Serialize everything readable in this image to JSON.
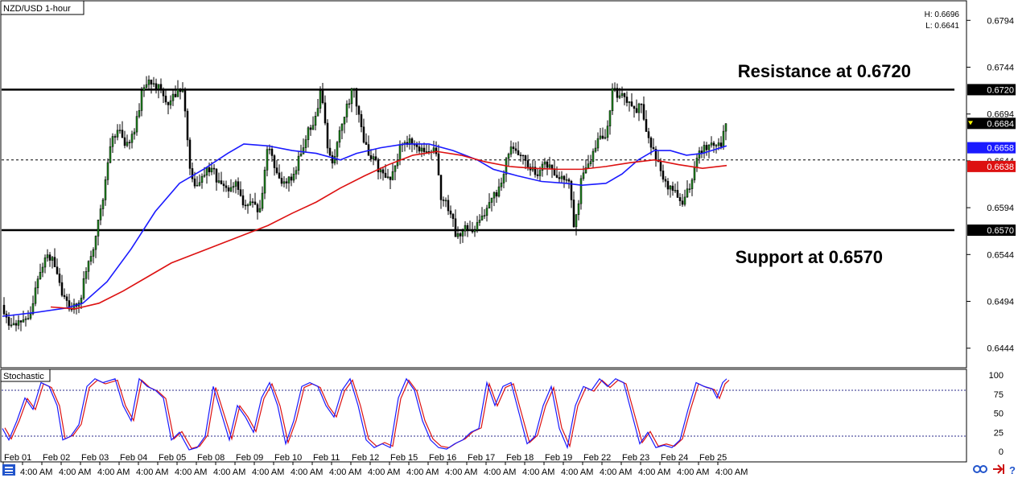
{
  "chart_data": {
    "type": "candlestick",
    "title": "NZD/USD 1-hour",
    "high_low": {
      "high_label": "H: 0.6696",
      "low_label": "L: 0.6641"
    },
    "price_axis": {
      "ylim": [
        0.6424,
        0.6814
      ],
      "ticks": [
        "0.6794",
        "0.6744",
        "0.6694",
        "0.6644",
        "0.6594",
        "0.6544",
        "0.6494",
        "0.6444"
      ],
      "tick_values": [
        0.6794,
        0.6744,
        0.6694,
        0.6644,
        0.6594,
        0.6544,
        0.6494,
        0.6444
      ]
    },
    "time_axis": {
      "labels": [
        "Feb 01",
        "4:00 AM",
        "Feb 02",
        "4:00 AM",
        "Feb 03",
        "4:00 AM",
        "Feb 04",
        "4:00 AM",
        "Feb 05",
        "4:00 AM",
        "Feb 08",
        "4:00 AM",
        "Feb 09",
        "4:00 AM",
        "Feb 10",
        "4:00 AM",
        "Feb 11",
        "4:00 AM",
        "Feb 12",
        "4:00 AM",
        "Feb 15",
        "4:00 AM",
        "Feb 16",
        "4:00 AM",
        "Feb 17",
        "4:00 AM",
        "Feb 18",
        "4:00 AM",
        "Feb 19",
        "4:00 AM",
        "Feb 22",
        "4:00 AM",
        "Feb 23",
        "4:00 AM",
        "Feb 24",
        "4:00 AM",
        "Feb 25",
        "4:00 AM"
      ]
    },
    "levels": [
      {
        "name": "Resistance",
        "value": 0.672,
        "tag": "0.6720",
        "annotation": "Resistance at 0.6720",
        "color": "#000000"
      },
      {
        "name": "Support",
        "value": 0.657,
        "tag": "0.6570",
        "annotation": "Support at 0.6570",
        "color": "#000000"
      }
    ],
    "current_price": {
      "value": 0.6684,
      "tag": "0.6684",
      "color": "#ffff00"
    },
    "bid_line": {
      "value": 0.6645
    },
    "moving_averages": [
      {
        "color": "#1a1aff",
        "last_value": 0.6658,
        "tag": "0.6658",
        "points": [
          [
            0,
            0.6478
          ],
          [
            40,
            0.6482
          ],
          [
            80,
            0.6487
          ],
          [
            100,
            0.6492
          ],
          [
            130,
            0.6515
          ],
          [
            160,
            0.655
          ],
          [
            190,
            0.659
          ],
          [
            220,
            0.662
          ],
          [
            250,
            0.6635
          ],
          [
            280,
            0.6652
          ],
          [
            300,
            0.6662
          ],
          [
            330,
            0.666
          ],
          [
            360,
            0.6655
          ],
          [
            390,
            0.6652
          ],
          [
            420,
            0.6645
          ],
          [
            440,
            0.6652
          ],
          [
            470,
            0.6658
          ],
          [
            500,
            0.6662
          ],
          [
            530,
            0.6662
          ],
          [
            560,
            0.6655
          ],
          [
            590,
            0.6645
          ],
          [
            610,
            0.6635
          ],
          [
            640,
            0.6628
          ],
          [
            670,
            0.6622
          ],
          [
            700,
            0.662
          ],
          [
            720,
            0.6618
          ],
          [
            750,
            0.662
          ],
          [
            770,
            0.663
          ],
          [
            790,
            0.6645
          ],
          [
            810,
            0.6655
          ],
          [
            830,
            0.6655
          ],
          [
            850,
            0.665
          ],
          [
            870,
            0.6652
          ],
          [
            900,
            0.666
          ]
        ]
      },
      {
        "color": "#dd1111",
        "last_value": 0.6638,
        "tag": "0.6638",
        "points": [
          [
            60,
            0.6488
          ],
          [
            90,
            0.6486
          ],
          [
            120,
            0.6492
          ],
          [
            150,
            0.6505
          ],
          [
            180,
            0.652
          ],
          [
            210,
            0.6535
          ],
          [
            240,
            0.6545
          ],
          [
            270,
            0.6555
          ],
          [
            300,
            0.6565
          ],
          [
            330,
            0.6575
          ],
          [
            360,
            0.6588
          ],
          [
            390,
            0.66
          ],
          [
            420,
            0.6615
          ],
          [
            450,
            0.6628
          ],
          [
            480,
            0.664
          ],
          [
            510,
            0.665
          ],
          [
            540,
            0.6654
          ],
          [
            570,
            0.665
          ],
          [
            600,
            0.6643
          ],
          [
            630,
            0.6638
          ],
          [
            660,
            0.6636
          ],
          [
            690,
            0.6635
          ],
          [
            720,
            0.6635
          ],
          [
            750,
            0.6638
          ],
          [
            780,
            0.6642
          ],
          [
            810,
            0.6645
          ],
          [
            840,
            0.664
          ],
          [
            870,
            0.6636
          ],
          [
            900,
            0.6639
          ]
        ]
      }
    ],
    "price_path": [
      [
        0,
        0.649
      ],
      [
        10,
        0.6465
      ],
      [
        22,
        0.6472
      ],
      [
        35,
        0.648
      ],
      [
        45,
        0.652
      ],
      [
        55,
        0.6545
      ],
      [
        65,
        0.6535
      ],
      [
        75,
        0.65
      ],
      [
        85,
        0.6485
      ],
      [
        95,
        0.649
      ],
      [
        105,
        0.653
      ],
      [
        115,
        0.656
      ],
      [
        125,
        0.66
      ],
      [
        135,
        0.6665
      ],
      [
        145,
        0.6675
      ],
      [
        155,
        0.666
      ],
      [
        165,
        0.668
      ],
      [
        175,
        0.6725
      ],
      [
        185,
        0.673
      ],
      [
        195,
        0.672
      ],
      [
        205,
        0.6705
      ],
      [
        215,
        0.6715
      ],
      [
        225,
        0.672
      ],
      [
        232,
        0.664
      ],
      [
        240,
        0.6615
      ],
      [
        250,
        0.663
      ],
      [
        260,
        0.6635
      ],
      [
        270,
        0.662
      ],
      [
        280,
        0.6615
      ],
      [
        290,
        0.662
      ],
      [
        300,
        0.659
      ],
      [
        310,
        0.66
      ],
      [
        320,
        0.659
      ],
      [
        330,
        0.666
      ],
      [
        340,
        0.663
      ],
      [
        350,
        0.662
      ],
      [
        360,
        0.6625
      ],
      [
        370,
        0.665
      ],
      [
        380,
        0.6675
      ],
      [
        390,
        0.669
      ],
      [
        395,
        0.6722
      ],
      [
        400,
        0.669
      ],
      [
        405,
        0.665
      ],
      [
        412,
        0.664
      ],
      [
        420,
        0.668
      ],
      [
        428,
        0.67
      ],
      [
        436,
        0.6725
      ],
      [
        445,
        0.668
      ],
      [
        455,
        0.665
      ],
      [
        465,
        0.664
      ],
      [
        475,
        0.6625
      ],
      [
        485,
        0.663
      ],
      [
        495,
        0.666
      ],
      [
        505,
        0.6665
      ],
      [
        515,
        0.666
      ],
      [
        525,
        0.665
      ],
      [
        535,
        0.666
      ],
      [
        540,
        0.6655
      ],
      [
        545,
        0.66
      ],
      [
        555,
        0.6595
      ],
      [
        565,
        0.656
      ],
      [
        575,
        0.6575
      ],
      [
        585,
        0.657
      ],
      [
        595,
        0.658
      ],
      [
        605,
        0.66
      ],
      [
        615,
        0.661
      ],
      [
        625,
        0.664
      ],
      [
        635,
        0.666
      ],
      [
        645,
        0.665
      ],
      [
        655,
        0.6635
      ],
      [
        665,
        0.663
      ],
      [
        675,
        0.664
      ],
      [
        685,
        0.663
      ],
      [
        695,
        0.6625
      ],
      [
        705,
        0.662
      ],
      [
        710,
        0.657
      ],
      [
        715,
        0.659
      ],
      [
        720,
        0.663
      ],
      [
        730,
        0.664
      ],
      [
        740,
        0.6665
      ],
      [
        750,
        0.667
      ],
      [
        758,
        0.672
      ],
      [
        765,
        0.6715
      ],
      [
        775,
        0.671
      ],
      [
        785,
        0.67
      ],
      [
        795,
        0.67
      ],
      [
        805,
        0.666
      ],
      [
        815,
        0.664
      ],
      [
        825,
        0.662
      ],
      [
        835,
        0.661
      ],
      [
        845,
        0.66
      ],
      [
        855,
        0.662
      ],
      [
        865,
        0.6655
      ],
      [
        875,
        0.666
      ],
      [
        885,
        0.6665
      ],
      [
        893,
        0.666
      ],
      [
        898,
        0.669
      ],
      [
        902,
        0.6684
      ]
    ],
    "stochastic": {
      "title": "Stochastic",
      "ylim": [
        0,
        100
      ],
      "ticks": [
        "100",
        "75",
        "50",
        "25",
        "0"
      ],
      "tick_values": [
        100,
        75,
        50,
        25,
        0
      ],
      "levels": [
        80,
        20
      ],
      "main_color": "#1a1aff",
      "signal_color": "#dd1111",
      "values": [
        [
          0,
          30
        ],
        [
          8,
          15
        ],
        [
          18,
          40
        ],
        [
          28,
          70
        ],
        [
          38,
          55
        ],
        [
          48,
          90
        ],
        [
          58,
          85
        ],
        [
          68,
          60
        ],
        [
          75,
          15
        ],
        [
          85,
          20
        ],
        [
          95,
          35
        ],
        [
          105,
          85
        ],
        [
          115,
          95
        ],
        [
          125,
          90
        ],
        [
          140,
          95
        ],
        [
          150,
          60
        ],
        [
          160,
          40
        ],
        [
          170,
          95
        ],
        [
          180,
          85
        ],
        [
          190,
          80
        ],
        [
          200,
          70
        ],
        [
          210,
          15
        ],
        [
          220,
          25
        ],
        [
          232,
          2
        ],
        [
          242,
          5
        ],
        [
          252,
          20
        ],
        [
          262,
          85
        ],
        [
          272,
          50
        ],
        [
          282,
          15
        ],
        [
          292,
          60
        ],
        [
          302,
          45
        ],
        [
          312,
          25
        ],
        [
          322,
          70
        ],
        [
          332,
          90
        ],
        [
          342,
          60
        ],
        [
          352,
          10
        ],
        [
          362,
          40
        ],
        [
          372,
          85
        ],
        [
          382,
          90
        ],
        [
          392,
          85
        ],
        [
          402,
          60
        ],
        [
          412,
          45
        ],
        [
          422,
          80
        ],
        [
          432,
          95
        ],
        [
          442,
          60
        ],
        [
          452,
          15
        ],
        [
          462,
          5
        ],
        [
          472,
          10
        ],
        [
          482,
          5
        ],
        [
          492,
          70
        ],
        [
          502,
          95
        ],
        [
          512,
          80
        ],
        [
          522,
          40
        ],
        [
          532,
          15
        ],
        [
          542,
          5
        ],
        [
          552,
          3
        ],
        [
          562,
          10
        ],
        [
          572,
          15
        ],
        [
          582,
          25
        ],
        [
          592,
          30
        ],
        [
          602,
          90
        ],
        [
          612,
          60
        ],
        [
          622,
          85
        ],
        [
          632,
          90
        ],
        [
          642,
          50
        ],
        [
          652,
          10
        ],
        [
          662,
          20
        ],
        [
          672,
          60
        ],
        [
          682,
          85
        ],
        [
          692,
          30
        ],
        [
          702,
          5
        ],
        [
          712,
          60
        ],
        [
          722,
          85
        ],
        [
          732,
          80
        ],
        [
          742,
          95
        ],
        [
          752,
          85
        ],
        [
          762,
          95
        ],
        [
          772,
          90
        ],
        [
          782,
          50
        ],
        [
          792,
          10
        ],
        [
          802,
          25
        ],
        [
          812,
          5
        ],
        [
          822,
          8
        ],
        [
          832,
          5
        ],
        [
          842,
          15
        ],
        [
          852,
          55
        ],
        [
          862,
          90
        ],
        [
          872,
          85
        ],
        [
          882,
          82
        ],
        [
          888,
          70
        ],
        [
          895,
          90
        ],
        [
          900,
          95
        ]
      ]
    },
    "bottom_icons": [
      "link-icon",
      "arrow-right-icon",
      "help-icon"
    ],
    "menu_icon": "menu-icon"
  }
}
